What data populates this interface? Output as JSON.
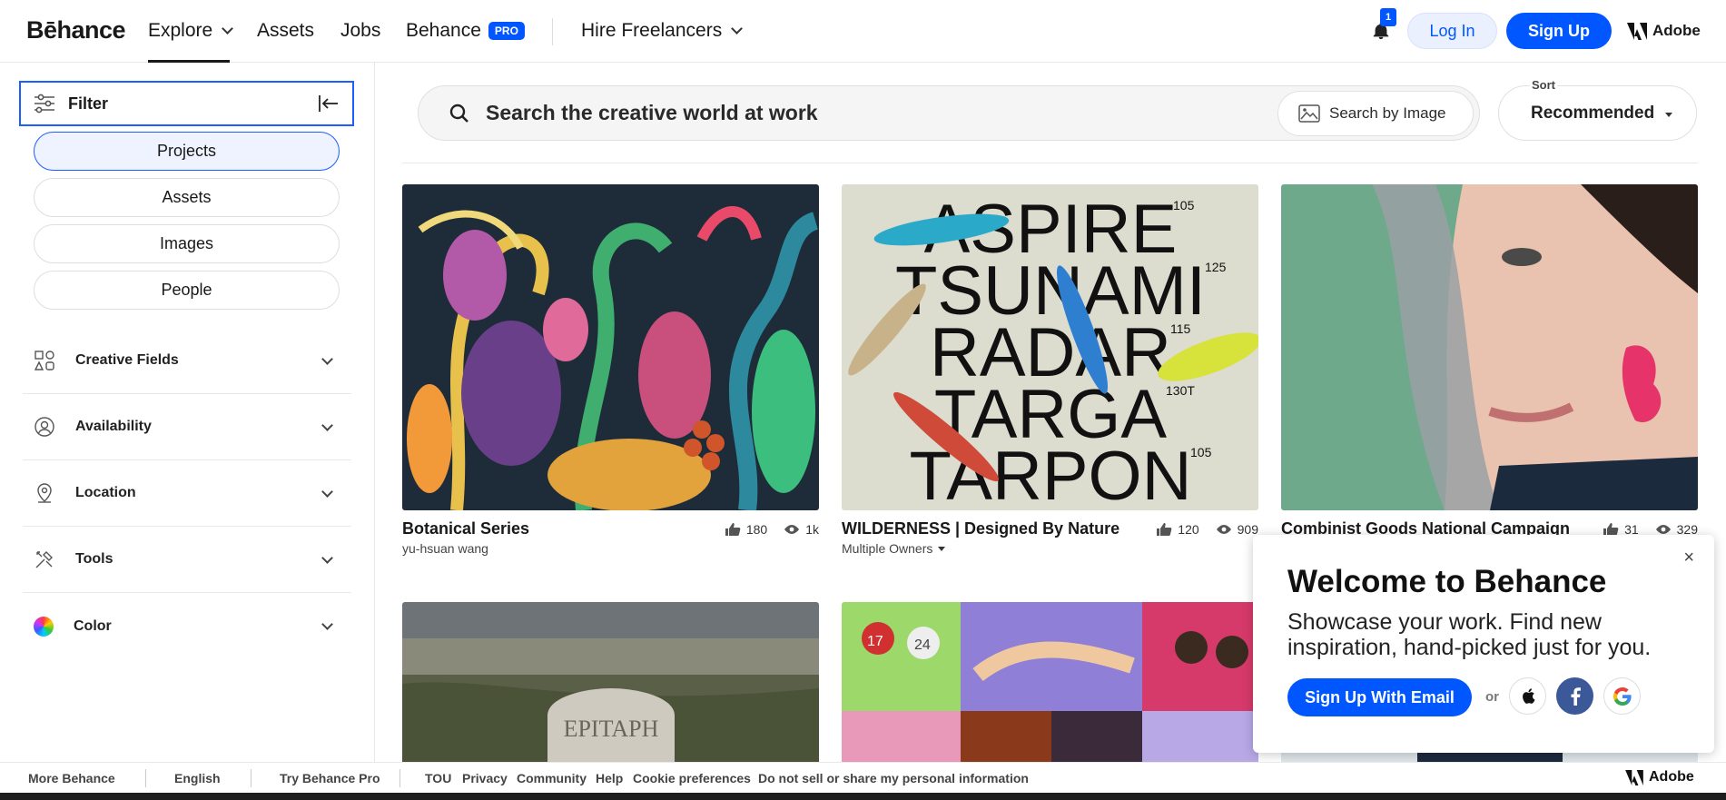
{
  "header": {
    "logo": "Bēhance",
    "nav": {
      "explore": "Explore",
      "assets": "Assets",
      "jobs": "Jobs",
      "behance": "Behance",
      "pro_badge": "PRO",
      "hire": "Hire Freelancers"
    },
    "notification_count": "1",
    "login": "Log In",
    "signup": "Sign Up",
    "adobe": "Adobe"
  },
  "sidebar": {
    "filter_label": "Filter",
    "tabs": [
      "Projects",
      "Assets",
      "Images",
      "People"
    ],
    "accordions": [
      "Creative Fields",
      "Availability",
      "Location",
      "Tools",
      "Color"
    ]
  },
  "search": {
    "placeholder": "Search the creative world at work",
    "by_image": "Search by Image"
  },
  "sort": {
    "label": "Sort",
    "value": "Recommended"
  },
  "cards": [
    {
      "title": "Botanical Series",
      "owner": "yu-hsuan wang",
      "likes": "180",
      "views": "1k"
    },
    {
      "title": "WILDERNESS | Designed By Nature",
      "owner": "Multiple Owners",
      "likes": "120",
      "views": "909",
      "art_words": [
        "ASPIRE",
        "TSUNAMI",
        "RADAR",
        "TARGA",
        "TARPON"
      ],
      "art_nums": [
        "105",
        "125",
        "115",
        "130T",
        "105"
      ]
    },
    {
      "title": "Combinist Goods National Campaign",
      "likes": "31",
      "views": "329"
    }
  ],
  "second_row": {
    "epitaph": "EPITAPH",
    "jersey_a": "17",
    "jersey_b": "24"
  },
  "welcome": {
    "title": "Welcome to Behance",
    "body": "Showcase your work. Find new inspiration, hand-picked just for you.",
    "email_button": "Sign Up With Email",
    "or": "or",
    "close": "×"
  },
  "footer": {
    "more": "More Behance",
    "language": "English",
    "try_pro": "Try Behance Pro",
    "links": [
      "TOU",
      "Privacy",
      "Community",
      "Help",
      "Cookie preferences",
      "Do not sell or share my personal information"
    ],
    "adobe": "Adobe"
  },
  "colors": {
    "accent": "#0057ff",
    "focus": "#1c5eff"
  }
}
